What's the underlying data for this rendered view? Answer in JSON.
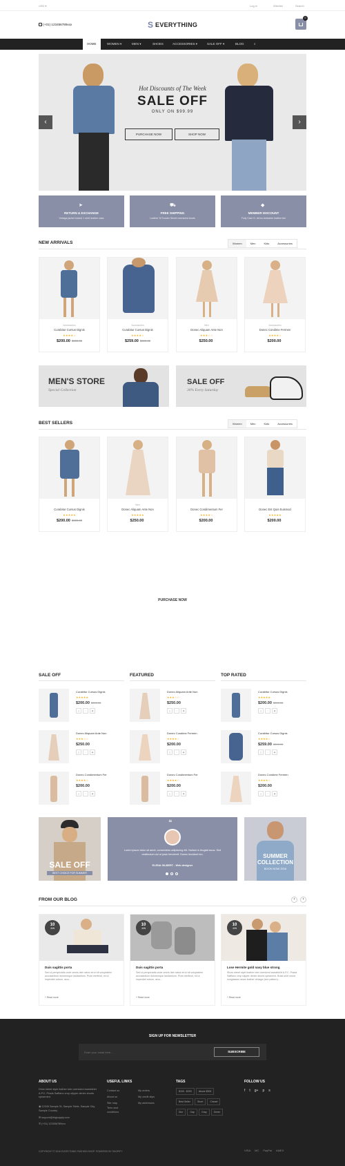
{
  "topbar": {
    "left": "USD ▾",
    "links": [
      "Log in",
      "Wishlist",
      "Search"
    ]
  },
  "header": {
    "phone": "(+01) 123456789xxx",
    "brand": "EVERYTHING",
    "brand_letter": "S",
    "cart_count": "0"
  },
  "nav": {
    "items": [
      "HOME",
      "WOMEN ▾",
      "MEN ▾",
      "SHOES",
      "ACCESSORIES ▾",
      "SALE OFF ▾",
      "BLOG"
    ]
  },
  "hero": {
    "kicker": "Hot Discounts of The Week",
    "title": "SALE OFF",
    "subtitle": "ONLY ON $99.99",
    "btn1": "PURCHASE NOW",
    "btn2": "SHOP NOW"
  },
  "features": [
    {
      "title": "RETURN & EXCHANGE",
      "desc": "Vintage jacket locked 1 shirt leather case"
    },
    {
      "title": "FREE SHIPPING",
      "desc": "Leather 3l Sunder Street oversized boots"
    },
    {
      "title": "MEMBER DISCOUNT",
      "desc": "Fully Care D. demo Ambaree leather tee"
    }
  ],
  "new_arrivals": {
    "title": "NEW ARRIVALS",
    "tabs": [
      "Women",
      "Men",
      "Kids",
      "Accessories"
    ],
    "products": [
      {
        "cat": "Accessories",
        "name": "Curabitur Cursus Dignis",
        "stars": "★★★★☆",
        "price": "$200.00",
        "old": "$300.00"
      },
      {
        "cat": "Accessories",
        "name": "Curabitur Cursus Dignis",
        "stars": "★★★★☆",
        "price": "$259.00",
        "old": "$300.00"
      },
      {
        "cat": "Men",
        "name": "Donec Aliquam Ante Non",
        "stars": "★★★☆☆",
        "price": "$250.00",
        "old": ""
      },
      {
        "cat": "Accessories",
        "name": "Donec Condime Fermen",
        "stars": "★★★★☆",
        "price": "$200.00",
        "old": ""
      }
    ]
  },
  "banners": {
    "left_title": "MEN'S STORE",
    "left_sub": "Special Collection",
    "right_title": "SALE OFF",
    "right_sub": "30% Every Saturday"
  },
  "best_sellers": {
    "title": "BEST SELLERS",
    "tabs": [
      "Women",
      "Men",
      "Kids",
      "Accessories"
    ],
    "products": [
      {
        "cat": "",
        "name": "Curabitur Cursus Dignis",
        "stars": "★★★★★",
        "price": "$200.00",
        "old": "$300.00"
      },
      {
        "cat": "Men",
        "name": "Donec Aliquam Ante Non",
        "stars": "★★★★★",
        "price": "$250.00",
        "old": ""
      },
      {
        "cat": "",
        "name": "Donec Condimentum Fer",
        "stars": "★★★★☆",
        "price": "$200.00",
        "old": ""
      },
      {
        "cat": "",
        "name": "Donec Est Quis Euismod",
        "stars": "★★★★★",
        "price": "$200.00",
        "old": ""
      }
    ]
  },
  "purchase_now": "PURCHASE NOW",
  "columns": [
    {
      "title": "SALE OFF",
      "items": [
        {
          "name": "Curabitur Cursus Dignis",
          "stars": "★★★★★",
          "price": "$200.00",
          "old": "$300.00"
        },
        {
          "name": "Donec Aliquam Ante Non",
          "stars": "★★★☆☆",
          "price": "$250.00",
          "old": ""
        },
        {
          "name": "Donec Condimentum Fer",
          "stars": "★★★★☆",
          "price": "$200.00",
          "old": ""
        }
      ]
    },
    {
      "title": "FEATURED",
      "items": [
        {
          "name": "Donec Aliquam Ante Non",
          "stars": "★★★☆☆",
          "price": "$250.00",
          "old": ""
        },
        {
          "name": "Donec Condime Fermen",
          "stars": "★★★★☆",
          "price": "$200.00",
          "old": ""
        },
        {
          "name": "Donec Condimentum Fer",
          "stars": "★★★★☆",
          "price": "$200.00",
          "old": ""
        }
      ]
    },
    {
      "title": "TOP RATED",
      "items": [
        {
          "name": "Curabitur Cursus Dignis",
          "stars": "★★★★★",
          "price": "$200.00",
          "old": "$300.00"
        },
        {
          "name": "Curabitur Cursus Dignis",
          "stars": "★★★★☆",
          "price": "$259.00",
          "old": "$300.00"
        },
        {
          "name": "Donec Condime Fermen",
          "stars": "★★★★☆",
          "price": "$200.00",
          "old": ""
        }
      ]
    }
  ],
  "promo": {
    "left_title": "SALE OFF",
    "left_sub": "BEST CHOICE FOR SUMMER",
    "quote": "Lorem ipsum dolor sit amet, consectetur adipiscing elit. Nullam in feugiat lacus. Sed vestibulum dui ut justo hendrerit. Donec tincidunt leo.",
    "author": "ELENA GILBERT - Web designer",
    "right_title": "SUMMER COLLECTION",
    "right_sub": "BOOK NOW 2016"
  },
  "blog": {
    "title": "FROM OUR BLOG",
    "posts": [
      {
        "day": "10",
        "mon": "JAN",
        "title": "Duis sagittis porta",
        "excerpt": "Sed ut perspiciatis unde omnis iste natus error sit voluptatem accusantium doloremque laudantium. Proin eleifend, mi ut imperdiet rutrum, arcu...",
        "more": "Read more"
      },
      {
        "day": "10",
        "mon": "JAN",
        "title": "Duis sagittis porta",
        "excerpt": "Sed ut perspiciatis unde omnis iste natus error sit voluptatem accusantium doloremque laudantium. Proin eleifend, mi ut imperdiet rutrum, arcu...",
        "more": "Read more"
      },
      {
        "day": "10",
        "mon": "JAN",
        "title": "Lose Hermite gold navy blue strong",
        "excerpt": "Show street style leather tote oversized sweatshirt A.P.C. Prada Saffiano crop slipper denim shorts spearmint. Braid skirt round sunglasses seam leather vintage (see pattern)...",
        "more": "Read more"
      }
    ]
  },
  "newsletter": {
    "title": "SIGN UP FOR NEWSLETTER",
    "placeholder": "Enter your email here...",
    "btn": "SUBSCRIBE"
  },
  "footer": {
    "about_title": "ABOUT US",
    "about_text": "Drive street style leather tote oversized sweatshirt A.P.C. Prada Saffiano crop slipper denim shorts spearmint.",
    "address": "12345 Sample St, Sample Table, Sample City, Sample Country",
    "email": "support@bigsupply.com",
    "phone": "(+01) 123456789xxx",
    "links_title": "USEFUL LINKS",
    "links_a": [
      "Contact us",
      "About us",
      "Site map",
      "Term and conditions"
    ],
    "links_b": [
      "My orders",
      "My credit slips",
      "My addresses"
    ],
    "tags_title": "TAGS",
    "tags": [
      "$100 - $200",
      "Above $300",
      "Best Seller",
      "Short",
      "Chanel",
      "Dior",
      "Gap",
      "Gray",
      "Green"
    ],
    "follow_title": "FOLLOW US",
    "social": [
      "f",
      "t",
      "g+",
      "p",
      "s"
    ],
    "copyright": "COPYRIGHT © 2016 EVERYTHING FASHION SHOP. POWERED BY SHOPIFY",
    "payments": [
      "VISA",
      "MC",
      "PayPal",
      "AMEX"
    ]
  }
}
